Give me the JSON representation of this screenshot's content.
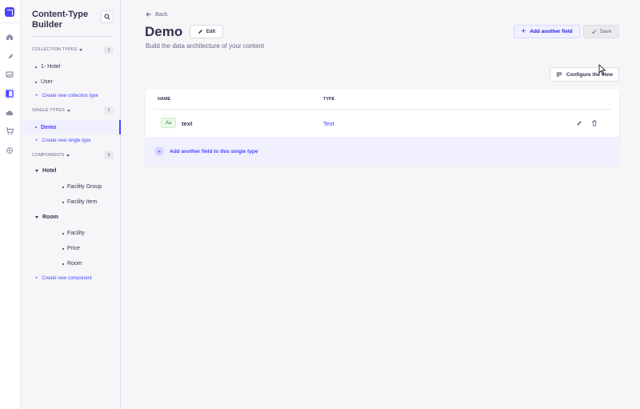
{
  "sidebar": {
    "title": "Content-Type Builder",
    "sections": {
      "collection_types": {
        "label": "COLLECTION TYPES",
        "count": "2"
      },
      "single_types": {
        "label": "SINGLE TYPES",
        "count": "1"
      },
      "components": {
        "label": "COMPONENTS",
        "count": "5"
      }
    },
    "collection_items": [
      "1- Hotel",
      "User"
    ],
    "create_collection": "Create new collection type",
    "single_items": [
      "Demo"
    ],
    "create_single": "Create new single type",
    "component_groups": [
      {
        "name": "Hotel",
        "items": [
          "Facility Group",
          "Facility Item"
        ]
      },
      {
        "name": "Room",
        "items": [
          "Facility",
          "Price",
          "Room"
        ]
      }
    ],
    "create_component": "Create new component"
  },
  "header": {
    "back_label": "Back",
    "title": "Demo",
    "edit_label": "Edit",
    "subtitle": "Build the data architecture of your content",
    "add_field_label": "Add another field",
    "save_label": "Save",
    "configure_label": "Configure the view"
  },
  "table": {
    "columns": [
      "NAME",
      "TYPE"
    ],
    "rows": [
      {
        "badge": "Aa",
        "name": "text",
        "type": "Text"
      }
    ],
    "add_row_label": "Add another field to this single type"
  },
  "colors": {
    "primary": "#4945ff",
    "primary_light": "#f0f0ff",
    "text_badge_bg": "#eafbe7",
    "text_badge_fg": "#328048"
  },
  "icons": {
    "rail": [
      "home-icon",
      "feather-icon",
      "media-icon",
      "layout-icon",
      "cloud-icon",
      "cart-icon",
      "gear-icon"
    ]
  }
}
